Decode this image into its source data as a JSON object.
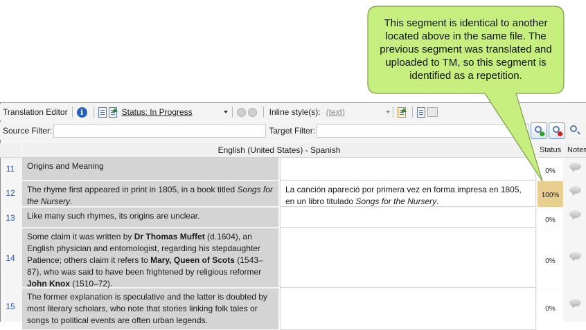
{
  "toolbar": {
    "title": "Translation Editor",
    "status_label": "Status: In Progress",
    "inline_label": "Inline style(s):",
    "inline_value": "(text)"
  },
  "filters": {
    "source_label": "Source Filter:",
    "target_label": "Target Filter:",
    "source_value": "",
    "target_value": ""
  },
  "grid": {
    "lang_header": "English (United States) - Spanish",
    "status_header": "Status",
    "notes_header": "Notes",
    "rows": [
      {
        "num": "11",
        "status": "0%"
      },
      {
        "num": "12",
        "status": "100%"
      },
      {
        "num": "13",
        "status": "0%"
      },
      {
        "num": "14",
        "status": "0%"
      },
      {
        "num": "15",
        "status": "0%"
      }
    ],
    "r11": {
      "src": "Origins and Meaning"
    },
    "r12": {
      "src_a": "The rhyme first appeared in print in 1805, in a book titled ",
      "src_i": "Songs for the Nursery",
      "src_b": ".",
      "tgt_a": "La canción apareció por primera vez en forma impresa en 1805, en un libro titulado ",
      "tgt_i": "Songs for the Nursery",
      "tgt_b": "."
    },
    "r13": {
      "src": "Like many such rhymes, its origins are unclear."
    },
    "r14": {
      "p1": "Some claim it was written by ",
      "b1": "Dr Thomas Muffet",
      "p2": " (d.1604), an English physician and entomologist, regarding his stepdaughter Patience; others claim it refers to ",
      "b2": "Mary, Queen of Scots",
      "p3": " (1543–87), who was said to have been frightened by religious reformer ",
      "b3": "John Knox",
      "p4": " (1510–72)."
    },
    "r15": {
      "src": "The former explanation is speculative and the latter is doubted by most literary scholars, who note that stories linking folk tales or songs to political events are often urban legends."
    }
  },
  "callout": {
    "text": "This segment is identical to another located above in the same file. The previous segment was translated and uploaded to TM, so this segment is identified as a repetition.",
    "fill": "#c6ef7f",
    "border": "#7f9b4a"
  },
  "colors": {
    "row_number": "#2a57a8",
    "repetition_status": "#e8cf90",
    "source_cell": "#d4d4d4"
  }
}
